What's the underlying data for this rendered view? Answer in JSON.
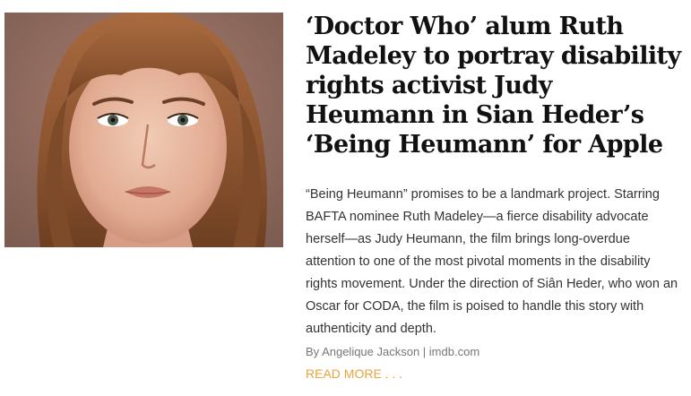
{
  "article": {
    "image_alt": "Portrait of Ruth Madeley",
    "headline": "‘Doctor Who’ alum Ruth Madeley to portray disability rights activist Judy Heumann in Sian Heder’s ‘Being Heumann’ for Apple",
    "summary": "“Being Heumann” promises to be a landmark project. Starring BAFTA nominee Ruth Madeley—a fierce disability advocate herself—as Judy Heumann, the film brings long-overdue attention to one of the most pivotal moments in the disability rights movement. Under the direction of Siân Heder, who won an Oscar for CODA, the film is poised to handle this story with authenticity and depth.",
    "byline": "By Angelique Jackson | imdb.com",
    "read_more": "READ MORE . . ."
  },
  "colors": {
    "headline": "#111111",
    "body_text": "#333333",
    "byline": "#777777",
    "read_more": "#e8a33d"
  }
}
